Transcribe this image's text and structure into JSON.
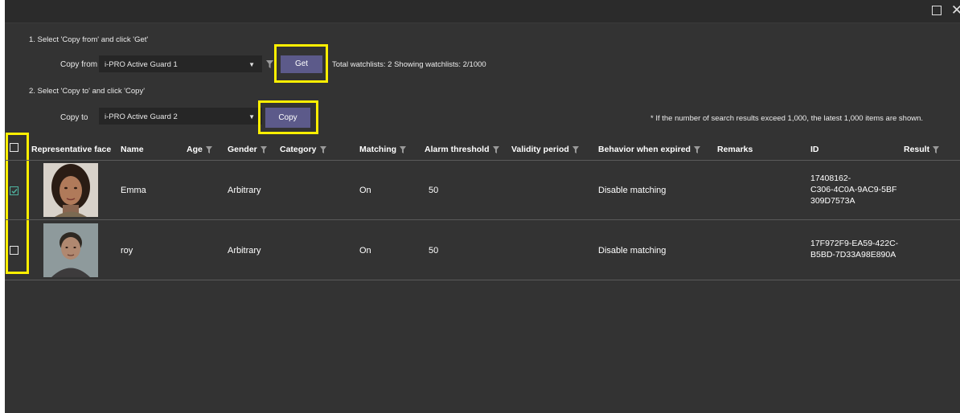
{
  "window": {
    "maximize_icon": "maximize-icon",
    "close_label": "✕"
  },
  "step1": {
    "instruction": "1. Select 'Copy from' and click 'Get'",
    "copy_from_label": "Copy from",
    "copy_from_value": "i-PRO Active Guard 1",
    "get_button": "Get",
    "summary": "Total watchlists: 2 Showing watchlists: 2/1000"
  },
  "step2": {
    "instruction": "2. Select 'Copy to' and click 'Copy'",
    "copy_to_label": "Copy to",
    "copy_to_value": "i-PRO Active Guard 2",
    "copy_button": "Copy",
    "note": "* If the number of search results exceed 1,000, the latest 1,000 items are shown."
  },
  "table": {
    "columns": [
      {
        "label": "Representative face",
        "filter": false
      },
      {
        "label": "Name",
        "filter": false
      },
      {
        "label": "Age",
        "filter": true
      },
      {
        "label": "Gender",
        "filter": true
      },
      {
        "label": "Category",
        "filter": true
      },
      {
        "label": "Matching",
        "filter": true
      },
      {
        "label": "Alarm threshold",
        "filter": true
      },
      {
        "label": "Validity period",
        "filter": true
      },
      {
        "label": "Behavior when expired",
        "filter": true
      },
      {
        "label": "Remarks",
        "filter": false
      },
      {
        "label": "ID",
        "filter": false
      },
      {
        "label": "Result",
        "filter": true
      }
    ],
    "rows": [
      {
        "checked": true,
        "name": "Emma",
        "age": "",
        "gender": "Arbitrary",
        "category": "",
        "matching": "On",
        "alarm_threshold": "50",
        "validity_period": "",
        "behavior": "Disable matching",
        "remarks": "",
        "id_lines": [
          "17408162-",
          "C306-4C0A-9AC9-5BF",
          "309D7573A"
        ],
        "result": ""
      },
      {
        "checked": false,
        "name": "roy",
        "age": "",
        "gender": "Arbitrary",
        "category": "",
        "matching": "On",
        "alarm_threshold": "50",
        "validity_period": "",
        "behavior": "Disable matching",
        "remarks": "",
        "id_lines": [
          "17F972F9-EA59-422C-",
          "B5BD-7D33A98E890A"
        ],
        "result": ""
      }
    ]
  },
  "colors": {
    "background": "#333333",
    "button": "#5c5a8a",
    "highlight": "#ffef00",
    "checkbox_checked": "#4fb3a0"
  }
}
